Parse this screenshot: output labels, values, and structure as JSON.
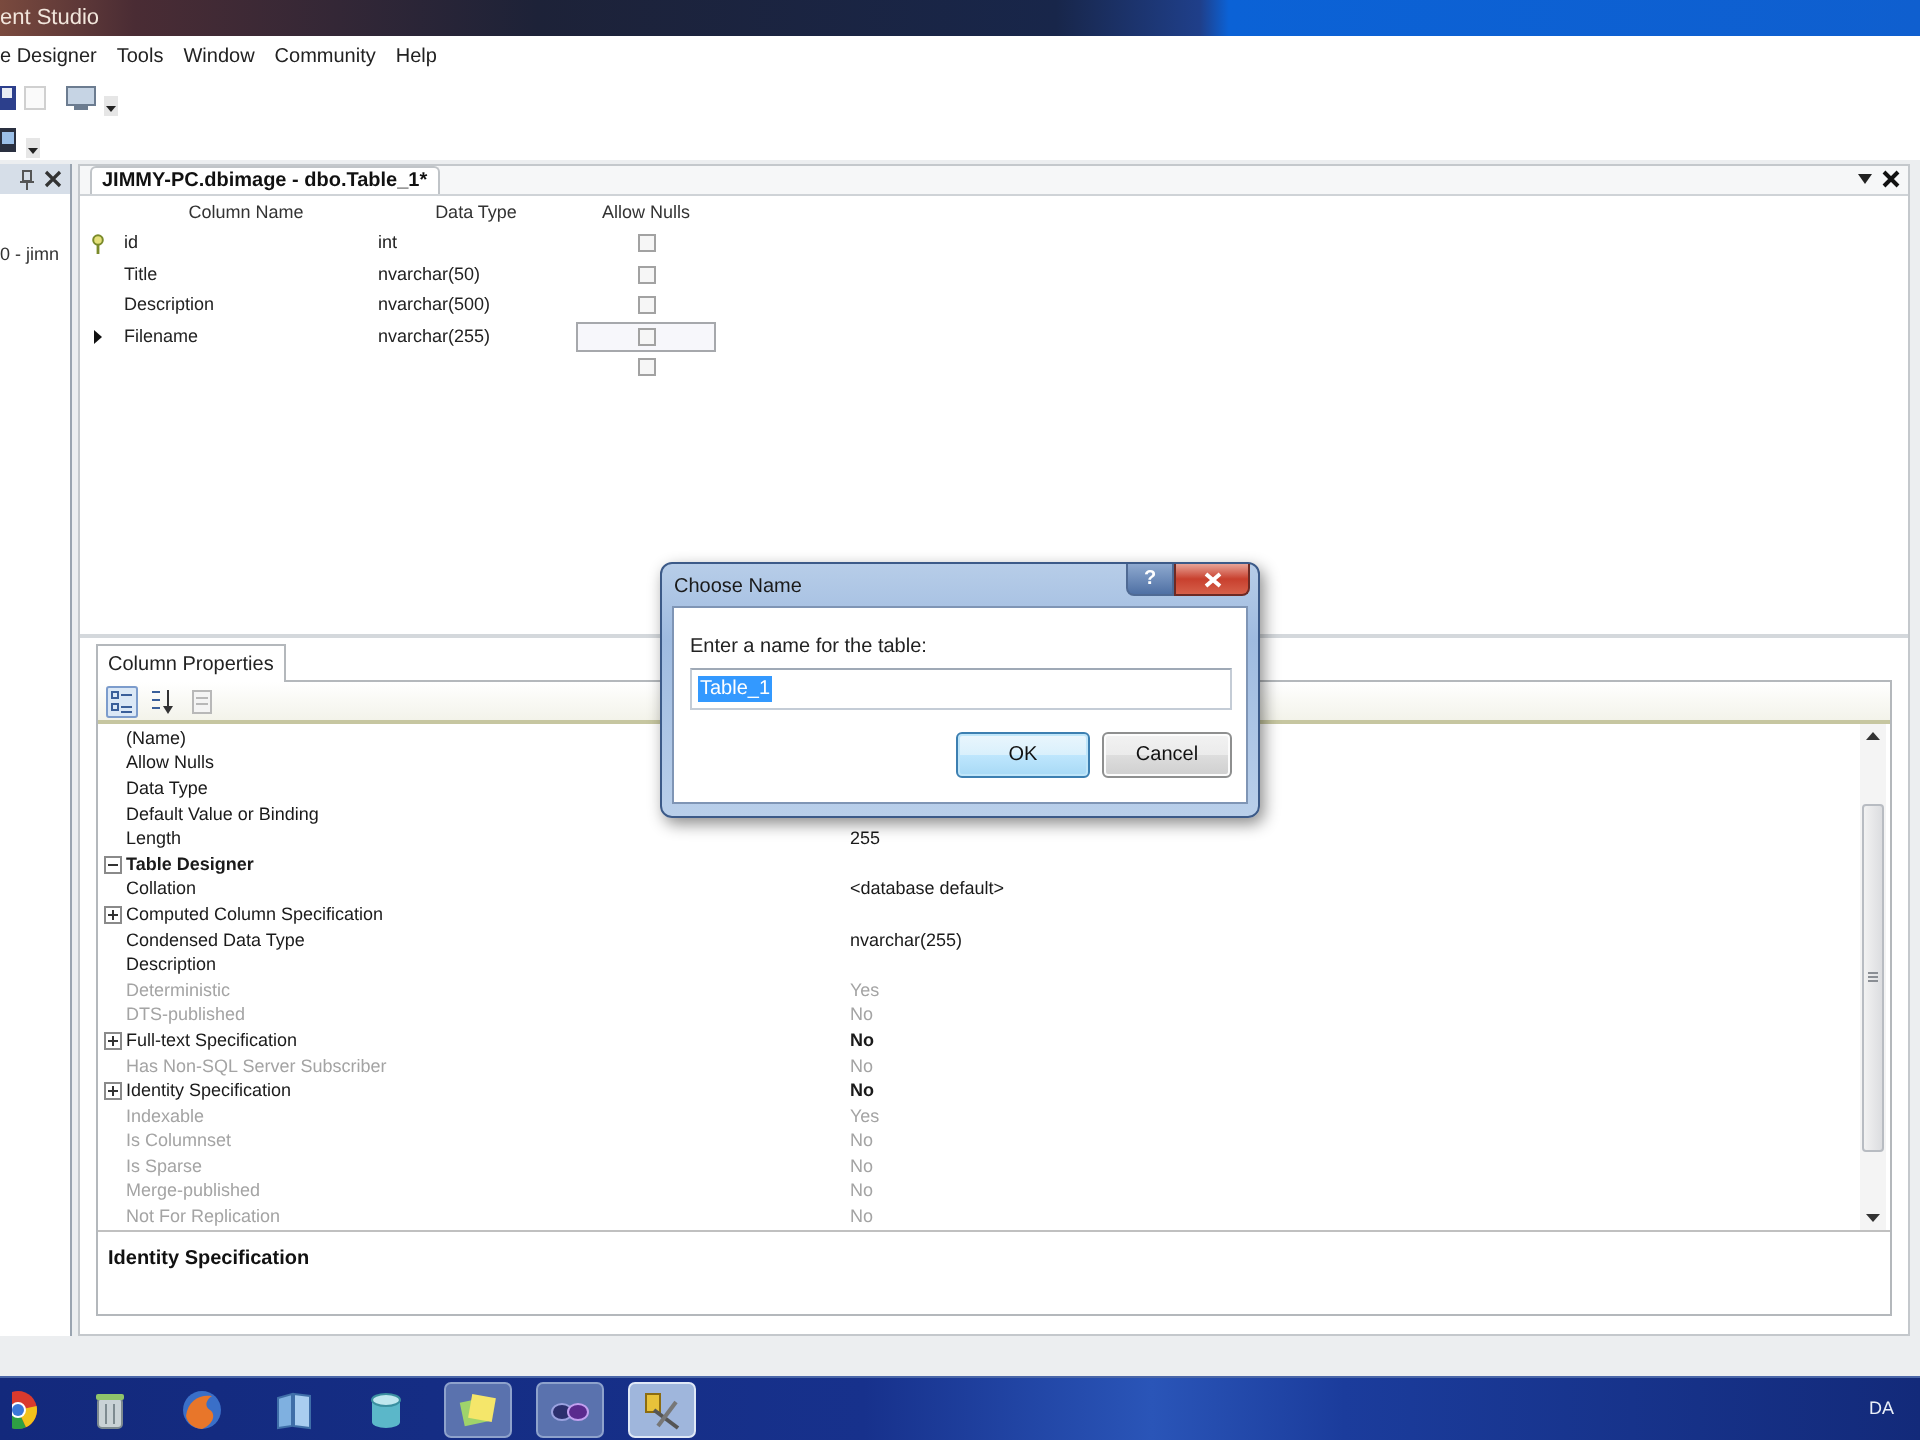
{
  "window": {
    "title": "ent Studio"
  },
  "menu": [
    "e Designer",
    "Tools",
    "Window",
    "Community",
    "Help"
  ],
  "object_explorer": {
    "item": "0 - jimn"
  },
  "document_tab": {
    "title": "JIMMY-PC.dbimage - dbo.Table_1*",
    "selected": true
  },
  "table_designer": {
    "columns": [
      "Column Name",
      "Data Type",
      "Allow Nulls"
    ],
    "rows": [
      {
        "column_name": "id",
        "data_type": "int",
        "allow_nulls": false,
        "primary_key": true,
        "selected": false
      },
      {
        "column_name": "Title",
        "data_type": "nvarchar(50)",
        "allow_nulls": false,
        "primary_key": false,
        "selected": false
      },
      {
        "column_name": "Description",
        "data_type": "nvarchar(500)",
        "allow_nulls": false,
        "primary_key": false,
        "selected": false
      },
      {
        "column_name": "Filename",
        "data_type": "nvarchar(255)",
        "allow_nulls": false,
        "primary_key": false,
        "selected": true
      },
      {
        "allow_nulls": false,
        "primary_key": false,
        "selected": false
      }
    ]
  },
  "column_properties": {
    "tab": "Column Properties",
    "toolbar": [
      {
        "kind": "categorized",
        "selected": true,
        "disabled": false
      },
      {
        "kind": "alphabetical",
        "selected": false,
        "disabled": false
      },
      {
        "kind": "pages",
        "selected": false,
        "disabled": true
      }
    ],
    "properties": [
      {
        "kind": "property",
        "name": "(Name)",
        "disabled": false
      },
      {
        "kind": "property",
        "name": "Allow Nulls",
        "disabled": false
      },
      {
        "kind": "property",
        "name": "Data Type",
        "disabled": false
      },
      {
        "kind": "property",
        "name": "Default Value or Binding",
        "disabled": false
      },
      {
        "kind": "property",
        "name": "Length",
        "value": "255",
        "disabled": false
      },
      {
        "kind": "category",
        "name": "Table Designer",
        "expanded": true,
        "children": [
          {
            "kind": "property",
            "name": "Collation",
            "value": "<database default>",
            "disabled": false
          },
          {
            "kind": "group",
            "name": "Computed Column Specification",
            "expanded": false,
            "disabled": false
          },
          {
            "kind": "property",
            "name": "Condensed Data Type",
            "value": "nvarchar(255)",
            "disabled": false
          },
          {
            "kind": "property",
            "name": "Description",
            "disabled": false
          },
          {
            "kind": "property",
            "name": "Deterministic",
            "value": "Yes",
            "disabled": true
          },
          {
            "kind": "property",
            "name": "DTS-published",
            "value": "No",
            "disabled": true
          },
          {
            "kind": "group",
            "name": "Full-text Specification",
            "value": "No",
            "expanded": false,
            "disabled": false
          },
          {
            "kind": "property",
            "name": "Has Non-SQL Server Subscriber",
            "value": "No",
            "disabled": true
          },
          {
            "kind": "group",
            "name": "Identity Specification",
            "value": "No",
            "expanded": false,
            "disabled": false
          },
          {
            "kind": "property",
            "name": "Indexable",
            "value": "Yes",
            "disabled": true
          },
          {
            "kind": "property",
            "name": "Is Columnset",
            "value": "No",
            "disabled": true
          },
          {
            "kind": "property",
            "name": "Is Sparse",
            "value": "No",
            "disabled": true
          },
          {
            "kind": "property",
            "name": "Merge-published",
            "value": "No",
            "disabled": true
          },
          {
            "kind": "property",
            "name": "Not For Replication",
            "value": "No",
            "disabled": true
          }
        ]
      }
    ],
    "description": {
      "title": "Identity Specification"
    }
  },
  "dialog": {
    "title": "Choose Name",
    "help": "?",
    "label": "Enter a name for the table:",
    "input": {
      "value": "Table_1",
      "highlighted": true
    },
    "buttons": [
      {
        "label": "OK",
        "default": true
      },
      {
        "label": "Cancel",
        "default": false
      }
    ]
  },
  "taskbar": {
    "apps": [
      {
        "kind": "ball",
        "running": false,
        "active": false
      },
      {
        "kind": "bin",
        "running": false,
        "active": false
      },
      {
        "kind": "globe",
        "running": false,
        "active": false
      },
      {
        "kind": "book",
        "running": false,
        "active": false
      },
      {
        "kind": "cylinder",
        "running": false,
        "active": false
      },
      {
        "kind": "notes",
        "running": true,
        "active": false
      },
      {
        "kind": "goggles",
        "running": true,
        "active": false
      },
      {
        "kind": "tools",
        "running": true,
        "active": true
      }
    ],
    "language": "DA"
  }
}
